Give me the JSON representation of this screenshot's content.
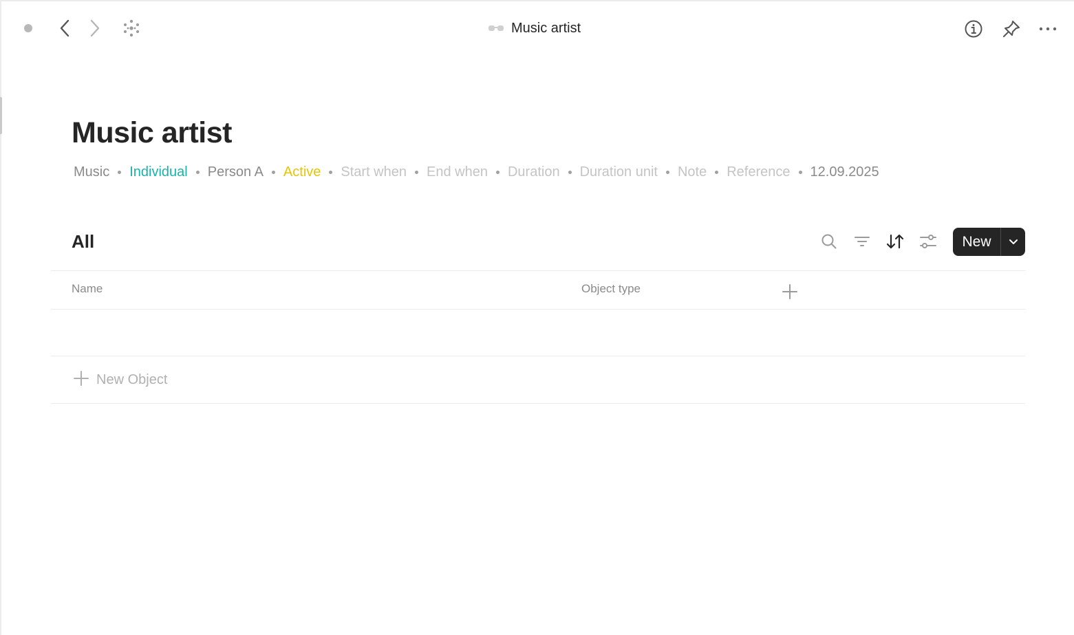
{
  "window": {
    "title": "Music artist",
    "title_icon": "glasses-icon"
  },
  "toolbar": {
    "icons": [
      "status-dot-icon",
      "back-arrow-icon",
      "forward-arrow-icon",
      "graph-icon",
      "info-icon",
      "pin-icon",
      "more-icon"
    ]
  },
  "page": {
    "title": "Music artist",
    "meta": [
      {
        "label": "Music",
        "color": "#8a8a8a"
      },
      {
        "label": "Individual",
        "color": "#1bb3a9"
      },
      {
        "label": "Person A",
        "color": "#8a8a8a"
      },
      {
        "label": "Active",
        "color": "#e8c400"
      },
      {
        "label": "Start when",
        "color": "#c4c4c4"
      },
      {
        "label": "End when",
        "color": "#c4c4c4"
      },
      {
        "label": "Duration",
        "color": "#c4c4c4"
      },
      {
        "label": "Duration unit",
        "color": "#c4c4c4"
      },
      {
        "label": "Note",
        "color": "#c4c4c4"
      },
      {
        "label": "Reference",
        "color": "#c4c4c4"
      },
      {
        "label": "12.09.2025",
        "color": "#8a8a8a"
      }
    ]
  },
  "view": {
    "title": "All",
    "new_label": "New",
    "tools": [
      "search-icon",
      "filter-icon",
      "sort-icon",
      "settings-icon"
    ]
  },
  "table": {
    "columns": [
      "Name",
      "Object type"
    ],
    "add_column_icon": "plus-icon",
    "new_object_label": "New Object"
  },
  "colors": {
    "accent_dark": "#252525",
    "muted": "#8a8a8a",
    "faint": "#c4c4c4"
  }
}
